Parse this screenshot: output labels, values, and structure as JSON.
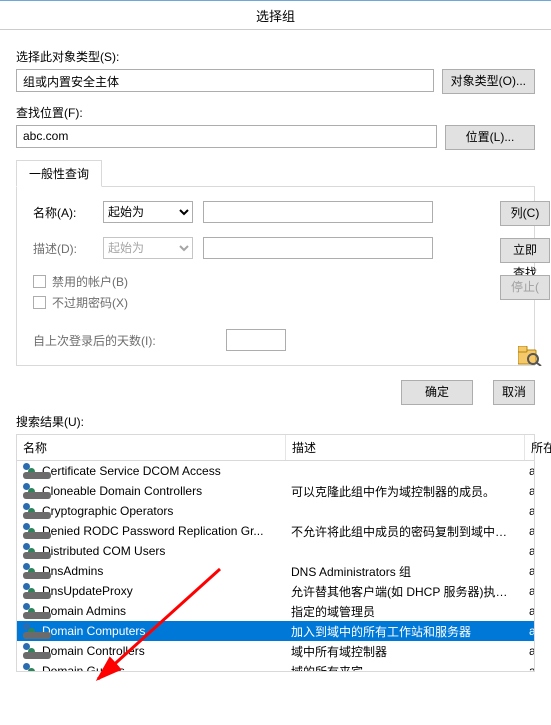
{
  "title": "选择组",
  "labels": {
    "object_type": "选择此对象类型(S):",
    "object_value": "组或内置安全主体",
    "btn_object": "对象类型(O)...",
    "location": "查找位置(F):",
    "location_value": "abc.com",
    "btn_location": "位置(L)...",
    "tab_general": "一般性查询",
    "name": "名称(A):",
    "desc": "描述(D):",
    "select_opt": "起始为",
    "chk_disabled": "禁用的帐户(B)",
    "chk_noexpire": "不过期密码(X)",
    "days_since": "自上次登录后的天数(I):",
    "btn_columns": "列(C)",
    "btn_findnow": "立即查找",
    "btn_stop": "停止(",
    "btn_ok": "确定",
    "btn_cancel": "取消",
    "results": "搜索结果(U):",
    "col_name": "名称",
    "col_desc": "描述",
    "col_loc": "所在文"
  },
  "rows": [
    {
      "name": "Certificate Service DCOM Access",
      "desc": "",
      "loc": "abc.c"
    },
    {
      "name": "Cloneable Domain Controllers",
      "desc": "可以克隆此组中作为域控制器的成员。",
      "loc": "abc.c"
    },
    {
      "name": "Cryptographic Operators",
      "desc": "",
      "loc": "abc.c"
    },
    {
      "name": "Denied RODC Password Replication Gr...",
      "desc": "不允许将此组中成员的密码复制到域中的所...",
      "loc": "abc.c"
    },
    {
      "name": "Distributed COM Users",
      "desc": "",
      "loc": "abc.c"
    },
    {
      "name": "DnsAdmins",
      "desc": "DNS Administrators 组",
      "loc": "abc.c"
    },
    {
      "name": "DnsUpdateProxy",
      "desc": "允许替其他客户端(如 DHCP 服务器)执行...",
      "loc": "abc.c"
    },
    {
      "name": "Domain Admins",
      "desc": "指定的域管理员",
      "loc": "abc.c"
    },
    {
      "name": "Domain Computers",
      "desc": "加入到域中的所有工作站和服务器",
      "loc": "abc.c",
      "selected": true
    },
    {
      "name": "Domain Controllers",
      "desc": "域中所有域控制器",
      "loc": "abc.c"
    },
    {
      "name": "Domain Guests",
      "desc": "域的所有来宾",
      "loc": "abc.c"
    }
  ]
}
